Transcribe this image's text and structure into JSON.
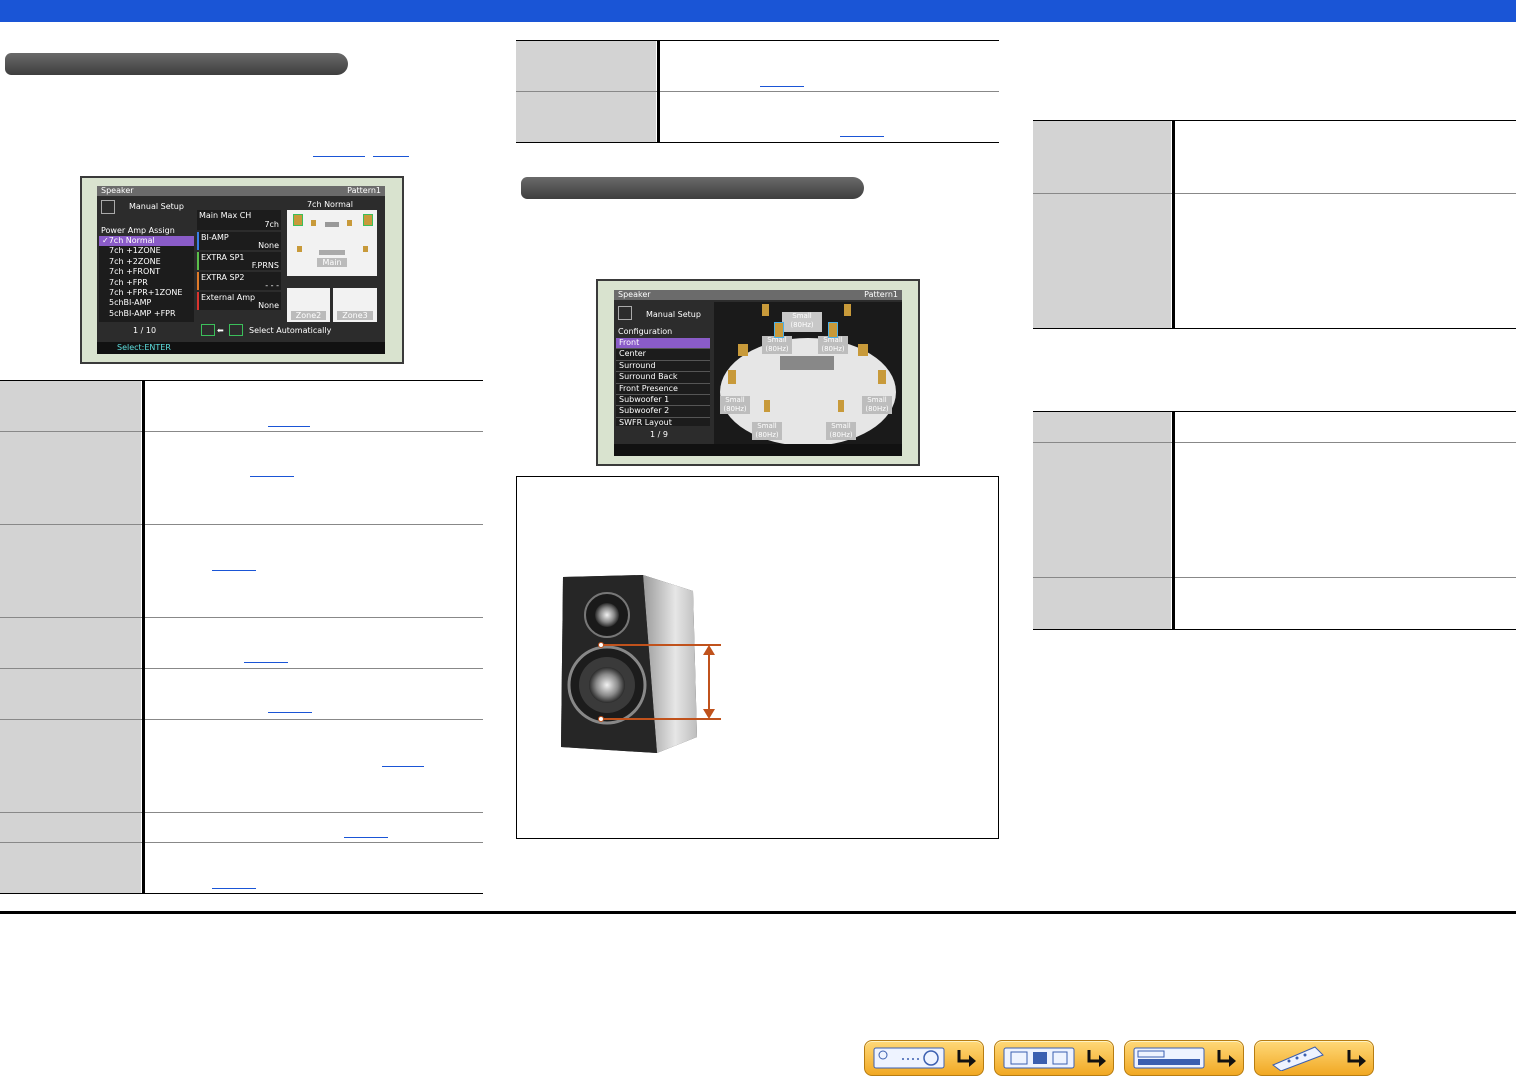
{
  "colors": {
    "accent": "#1a55d6",
    "highlight": "#8a5cc8",
    "arrow": "#c0521c"
  },
  "screen1": {
    "title": "Speaker",
    "pattern": "Pattern1",
    "menu": "Manual Setup",
    "section": "Power Amp Assign",
    "options": [
      "✓7ch Normal",
      "7ch +1ZONE",
      "7ch +2ZONE",
      "7ch +FRONT",
      "7ch +FPR",
      "7ch +FPR+1ZONE",
      "5chBI-AMP",
      "5chBI-AMP +FPR"
    ],
    "page": "1 / 10",
    "mode_title": "7ch Normal",
    "params": [
      {
        "label": "Main Max CH",
        "value": "7ch"
      },
      {
        "label": "BI-AMP",
        "value": "None"
      },
      {
        "label": "EXTRA SP1",
        "value": "F.PRNS"
      },
      {
        "label": "EXTRA SP2",
        "value": "- - -"
      },
      {
        "label": "External Amp",
        "value": "None"
      }
    ],
    "zones": [
      "Main",
      "Zone2",
      "Zone3"
    ],
    "auto": "Select Automatically",
    "footer": "Select:ENTER"
  },
  "screen2": {
    "title": "Speaker",
    "pattern": "Pattern1",
    "menu": "Manual Setup",
    "section": "Configuration",
    "items": [
      "Front",
      "Center",
      "Surround",
      "Surround Back",
      "Front Presence",
      "Subwoofer 1",
      "Subwoofer 2",
      "SWFR Layout"
    ],
    "page": "1 / 9",
    "speaker_labels": [
      "Small (80Hz)",
      "Small (80Hz)",
      "Small (80Hz)",
      "Small (80Hz)",
      "Small (80Hz)",
      "Small (80Hz)",
      "Small (80Hz)"
    ]
  }
}
